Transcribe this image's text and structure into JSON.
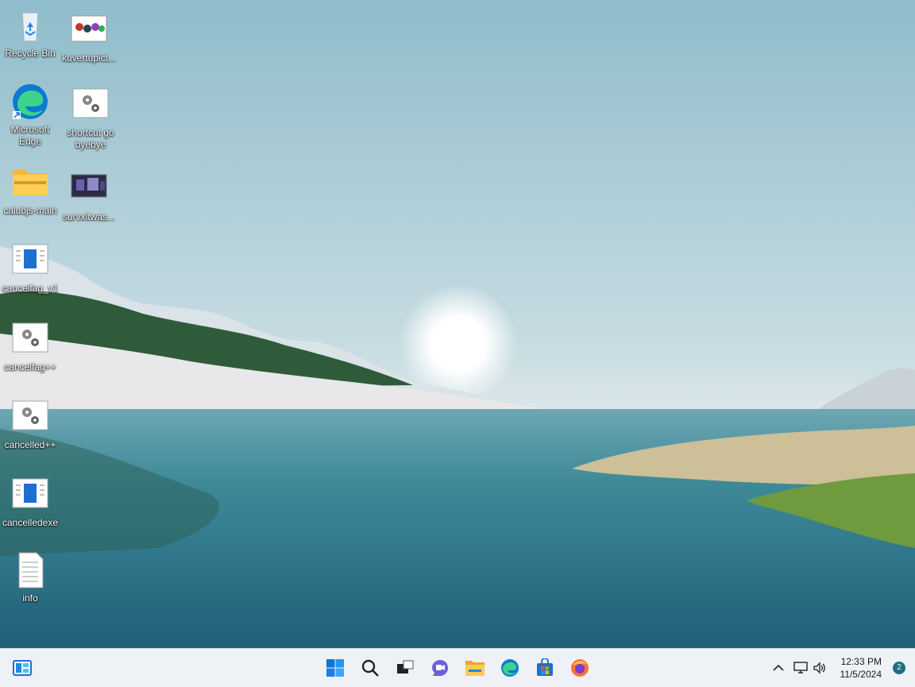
{
  "desktop": {
    "icons": [
      {
        "label": "Recycle Bin",
        "icon": "recycle-bin-icon"
      },
      {
        "label": "kuvertupict...",
        "icon": "image-thumbnail-icon"
      },
      {
        "label": "Microsoft Edge",
        "icon": "edge-icon"
      },
      {
        "label": "shortcut go byebye",
        "icon": "gear-file-icon"
      },
      {
        "label": "calubjs-main",
        "icon": "folder-zip-icon"
      },
      {
        "label": "survxltwas...",
        "icon": "image-thumbnail-icon"
      },
      {
        "label": "cancelfag_v1",
        "icon": "document-app-icon"
      },
      {
        "label": "cancelfag++",
        "icon": "gear-file-icon"
      },
      {
        "label": "cancelled++",
        "icon": "gear-file-icon"
      },
      {
        "label": "cancelledexe",
        "icon": "document-app-icon"
      },
      {
        "label": "info",
        "icon": "text-file-icon"
      }
    ]
  },
  "taskbar": {
    "widgets": "widgets-icon",
    "pinned": [
      "windows-start-icon",
      "search-icon",
      "task-view-icon",
      "chat-icon",
      "file-explorer-icon",
      "edge-icon",
      "store-icon",
      "firefox-icon"
    ],
    "tray": {
      "chevron": "chevron-up-icon",
      "network": "network-icon",
      "volume": "volume-icon"
    },
    "clock": {
      "time": "12:33 PM",
      "date": "11/5/2024"
    },
    "notification_count": "2"
  },
  "colors": {
    "accent": "#0078d4",
    "taskbar_bg": "#eef1f6"
  }
}
